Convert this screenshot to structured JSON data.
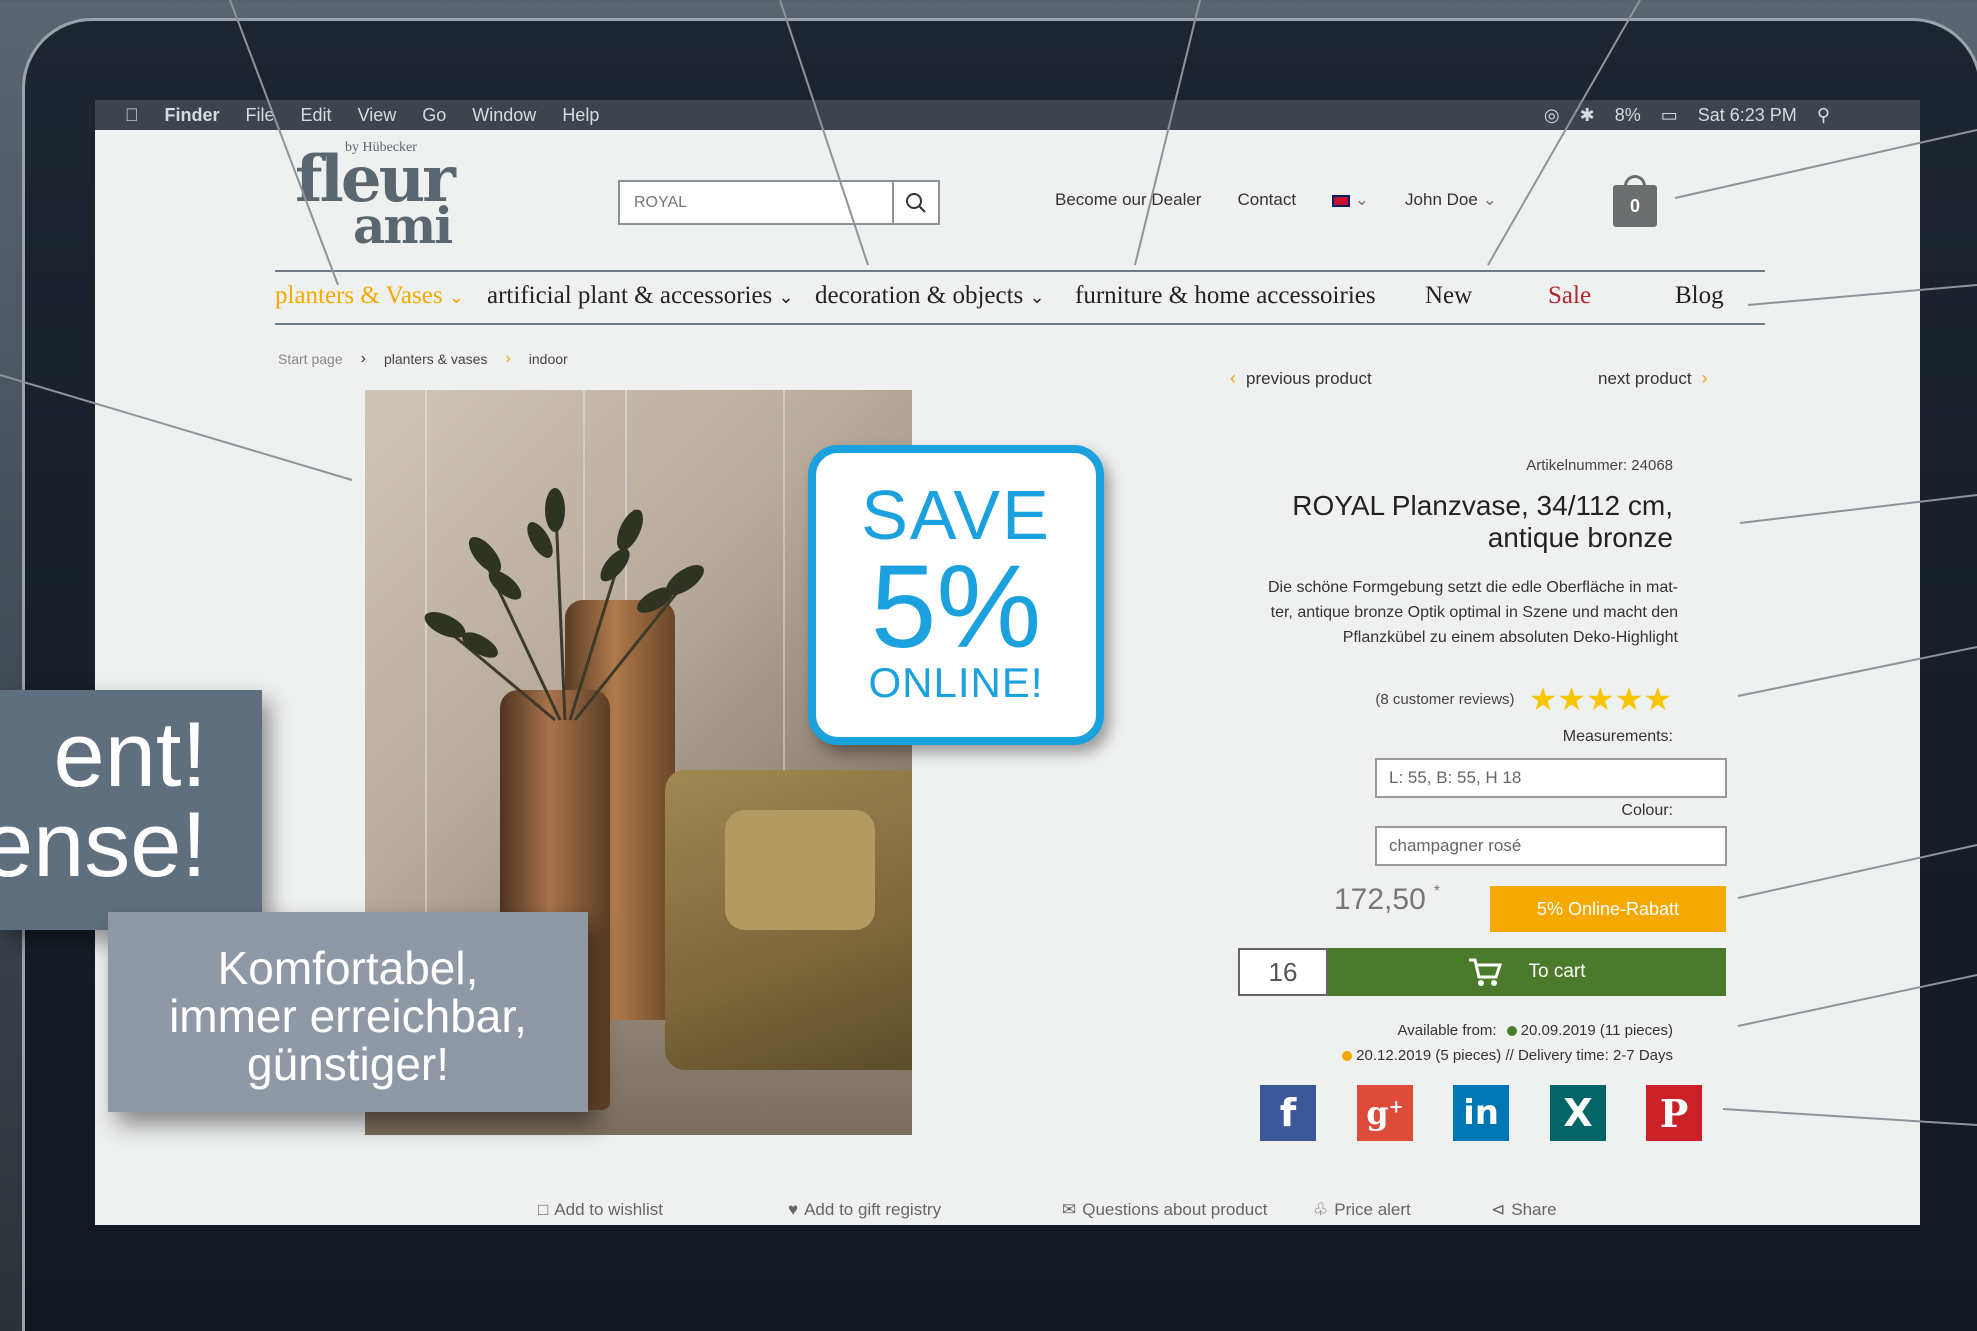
{
  "menubar": {
    "app": "Finder",
    "items": [
      "File",
      "Edit",
      "View",
      "Go",
      "Window",
      "Help"
    ],
    "status": [
      "8%",
      "Sat 6:23 PM"
    ]
  },
  "header": {
    "logo_by": "by Hübecker",
    "logo_word1": "fleur",
    "logo_word2": "ami",
    "search_value": "ROYAL",
    "links": [
      "Become our Dealer",
      "Contact"
    ],
    "user": "John Doe",
    "cart_count": "0"
  },
  "nav": {
    "items": [
      {
        "label": "planters & Vases",
        "active": true
      },
      {
        "label": "artificial plant & accessories"
      },
      {
        "label": "decoration & objects"
      },
      {
        "label": "furniture & home accessoiries"
      },
      {
        "label": "New"
      },
      {
        "label": "Sale"
      },
      {
        "label": "Blog"
      }
    ]
  },
  "breadcrumb": [
    "Start page",
    "planters & vases",
    "indoor"
  ],
  "badge": {
    "line1": "SAVE",
    "line2": "5%",
    "line3": "ONLINE!"
  },
  "product": {
    "prev": "previous product",
    "next": "next product",
    "artnr": "Artikelnummer: 24068",
    "title_line1": "ROYAL Planzvase, 34/112 cm,",
    "title_line2": "antique bronze",
    "desc_line1": "Die schöne Formgebung setzt die edle Oberfläche in mat-",
    "desc_line2": "ter, antique bronze Optik optimal in Szene und macht den",
    "desc_line3": "Pflanzkübel zu einem absoluten Deko-Highlight",
    "reviews": "(8 customer reviews)",
    "rating": 5,
    "measurements_label": "Measurements:",
    "measurements": "L: 55, B: 55, H 18",
    "colour_label": "Colour:",
    "colour": "champagner rosé",
    "price": "172,50",
    "price_star": "*",
    "rabatt": "5% Online-Rabatt",
    "qty": "16",
    "to_cart": "To cart",
    "avail_label": "Available from:",
    "avail_date1": "20.09.2019 (11 pieces)",
    "avail_date2": "20.12.2019 (5 pieces)",
    "delivery": "//  Delivery time: 2-7 Days",
    "dot_green": "#4a7a2a",
    "dot_orange": "#f5a800"
  },
  "social": [
    {
      "name": "facebook",
      "glyph": "f",
      "color": "#3b5998"
    },
    {
      "name": "googleplus",
      "glyph": "g+",
      "color": "#dd4b39"
    },
    {
      "name": "linkedin",
      "glyph": "in",
      "color": "#0077b5"
    },
    {
      "name": "xing",
      "glyph": "X",
      "color": "#026466"
    },
    {
      "name": "pinterest",
      "glyph": "P",
      "color": "#cb2027"
    }
  ],
  "actions": {
    "wishlist": "Add to wishlist",
    "gift": "Add to gift registry",
    "questions": "Questions about product",
    "price_alert": "Price alert",
    "share": "Share"
  },
  "overlay": {
    "big_line1": "ent!",
    "big_line2": "ense!",
    "small_line1": "Komfortabel,",
    "small_line2": "immer erreichbar,",
    "small_line3": "günstiger!"
  },
  "colors": {
    "accent_orange": "#f5a800",
    "accent_blue": "#1aa1de",
    "sale_red": "#b3262b",
    "cart_green": "#4a7a2a"
  }
}
